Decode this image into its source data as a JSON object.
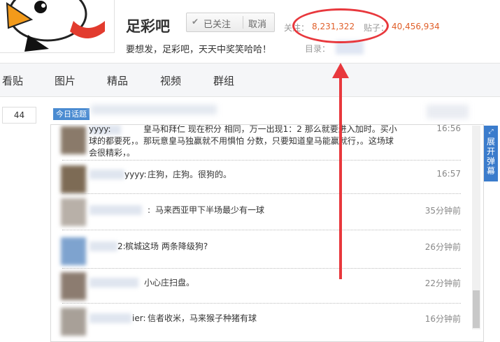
{
  "header": {
    "forum_name": "足彩吧",
    "follow_button": {
      "state_label": "已关注",
      "cancel_label": "取消"
    },
    "stats": {
      "followers_label": "关注：",
      "followers_value": "8,231,322",
      "posts_label": "贴子：",
      "posts_value": "40,456,934"
    },
    "slogan": "要想发，足彩吧，天天中奖笑哈哈！",
    "directory_label": "目录："
  },
  "nav": {
    "tabs": [
      "看贴",
      "图片",
      "精品",
      "视频",
      "群组"
    ]
  },
  "content": {
    "count_box": "44",
    "today_tag": "今日话题",
    "danmu": [
      {
        "user_suffix": "yyyy:",
        "text": "皇马和拜仁 现在积分 相同，万一出现1：2 那么就要进入加时。买小\n球的都要死，。那玩意皇马独赢就不用惧怕 分数，只要知道皇马能赢就行，。这场球\n会很精彩，。",
        "time": "16:56"
      },
      {
        "user_suffix": "yyyy:",
        "text": "庄狗，庄狗。很狗的。",
        "time": "16:57"
      },
      {
        "user_suffix": ":",
        "text": "马来西亚甲下半场最少有一球",
        "time": "35分钟前"
      },
      {
        "user_suffix": "2:",
        "text": "槟城这场 两条降级狗?",
        "time": "26分钟前"
      },
      {
        "user_suffix": "",
        "text": "小心庄扫盘。",
        "time": "22分钟前"
      },
      {
        "user_suffix": "ier:",
        "text": "信者收米，马来猴子种猪有球",
        "time": "16分钟前"
      }
    ],
    "expand_button": {
      "icon": "expand-icon",
      "label": "展开弹幕"
    }
  },
  "colors": {
    "accent": "#e0602b",
    "annotation": "#e8383d",
    "button_blue": "#3b7ccc"
  }
}
